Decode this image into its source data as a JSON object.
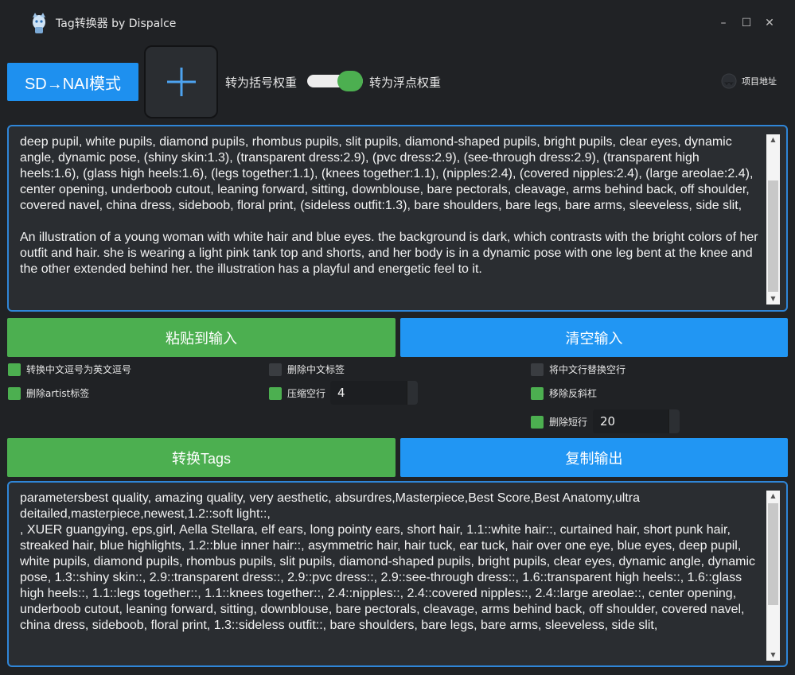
{
  "window": {
    "title": "Tag转换器 by Dispalce",
    "minimize": "–",
    "maximize": "☐",
    "close": "✕"
  },
  "toolbar": {
    "mode_label": "SD→NAI模式",
    "toggle_left_label": "转为括号权重",
    "toggle_right_label": "转为浮点权重",
    "toggle_state": "on",
    "project_label": "项目地址",
    "icons": {
      "add": "plus-icon",
      "app": "app-logo-icon",
      "project": "github-icon"
    }
  },
  "input": {
    "text": "deep pupil, white pupils, diamond pupils, rhombus pupils, slit pupils, diamond-shaped pupils, bright pupils, clear eyes, dynamic angle, dynamic pose, (shiny skin:1.3), (transparent dress:2.9), (pvc dress:2.9), (see-through dress:2.9), (transparent high heels:1.6), (glass high heels:1.6), (legs together:1.1), (knees together:1.1), (nipples:2.4), (covered nipples:2.4), (large areolae:2.4), center opening, underboob cutout, leaning forward, sitting, downblouse, bare pectorals, cleavage, arms behind back, off shoulder, covered navel, china dress, sideboob, floral print, (sideless outfit:1.3), bare shoulders, bare legs, bare arms, sleeveless, side slit,\n\nAn illustration of a young woman with white hair and blue eyes. the background is dark, which contrasts with the bright colors of her outfit and hair. she is wearing a light pink tank top and shorts, and her body is in a dynamic pose with one leg bent at the knee and the other extended behind her. the illustration has a playful and energetic feel to it."
  },
  "buttons": {
    "paste": "粘贴到输入",
    "clear": "清空输入",
    "convert": "转换Tags",
    "copy": "复制输出"
  },
  "options": {
    "comma": {
      "label": "转换中文逗号为英文逗号",
      "checked": true
    },
    "remove_cn_tags": {
      "label": "删除中文标签",
      "checked": false
    },
    "cn_newline": {
      "label": "将中文行替换空行",
      "checked": false
    },
    "remove_artist": {
      "label": "删除artist标签",
      "checked": true
    },
    "compress_blank": {
      "label": "压缩空行",
      "checked": true,
      "value": "4"
    },
    "remove_backslash": {
      "label": "移除反斜杠",
      "checked": true
    },
    "remove_short": {
      "label": "删除短行",
      "checked": true,
      "value": "20"
    }
  },
  "output": {
    "text": "parametersbest quality, amazing quality, very aesthetic, absurdres,Masterpiece,Best Score,Best Anatomy,ultra deitailed,masterpiece,newest,1.2::soft light::,\n, XUER guangying, eps,girl, Aella Stellara, elf ears, long pointy ears, short hair, 1.1::white hair::, curtained hair, short punk hair, streaked hair, blue highlights, 1.2::blue inner hair::, asymmetric hair, hair tuck, ear tuck, hair over one eye, blue eyes, deep pupil, white pupils, diamond pupils, rhombus pupils, slit pupils, diamond-shaped pupils, bright pupils, clear eyes, dynamic angle, dynamic pose, 1.3::shiny skin::, 2.9::transparent dress::, 2.9::pvc dress::, 2.9::see-through dress::, 1.6::transparent high heels::, 1.6::glass high heels::, 1.1::legs together::, 1.1::knees together::, 2.4::nipples::, 2.4::covered nipples::, 2.4::large areolae::, center opening, underboob cutout, leaning forward, sitting, downblouse, bare pectorals, cleavage, arms behind back, off shoulder, covered navel, china dress, sideboob, floral print, 1.3::sideless outfit::, bare shoulders, bare legs, bare arms, sleeveless, side slit,"
  },
  "colors": {
    "background": "#202225",
    "accent_blue": "#2196f3",
    "accent_green": "#4caf50",
    "focus_border": "#2f86d8"
  }
}
